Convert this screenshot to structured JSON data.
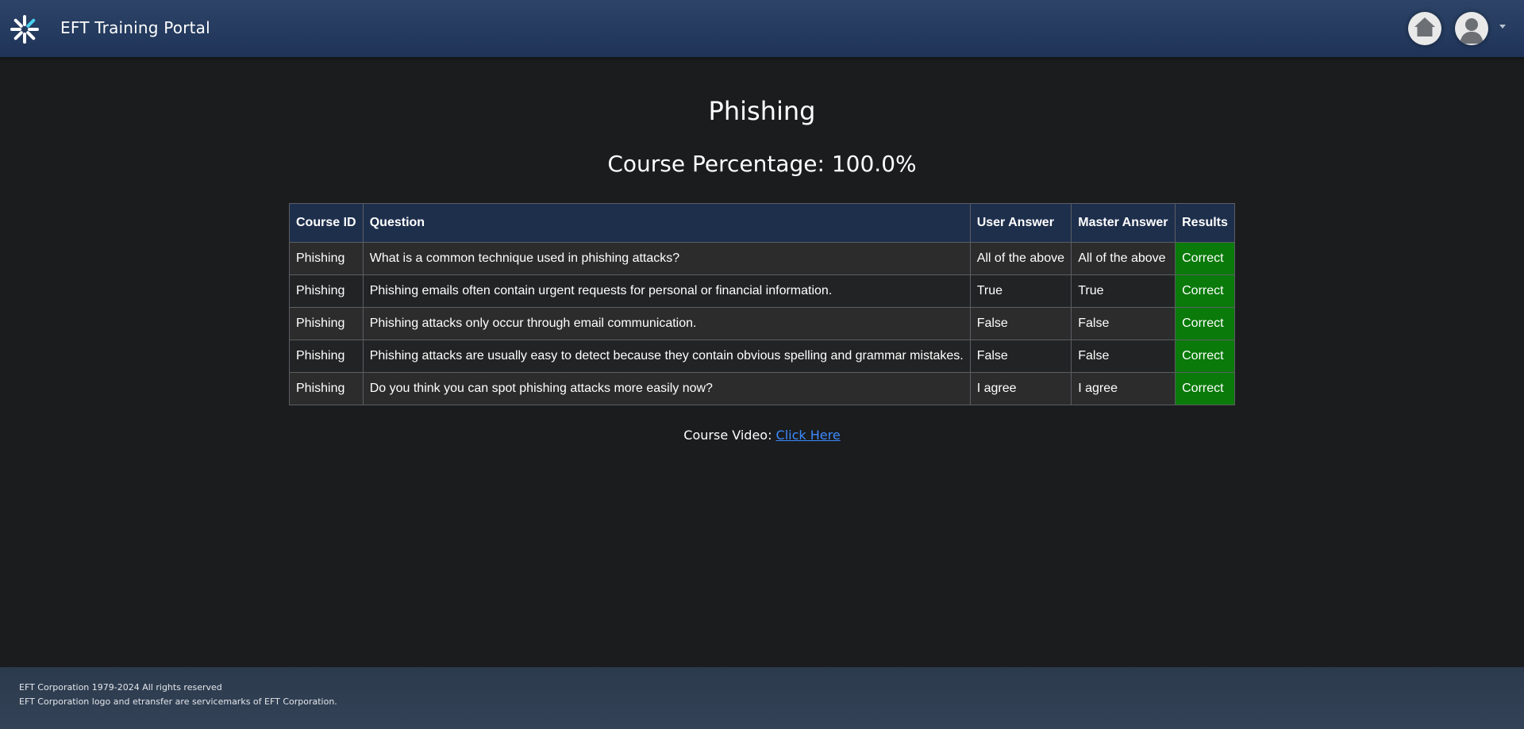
{
  "header": {
    "app_title": "EFT Training Portal",
    "logo_icon": "asterisk-logo-icon",
    "home_icon": "home-icon",
    "avatar_icon": "user-avatar-icon",
    "menu_icon": "caret-down-icon"
  },
  "main": {
    "title": "Phishing",
    "percentage_text": "Course Percentage: 100.0%"
  },
  "table": {
    "headers": [
      "Course ID",
      "Question",
      "User Answer",
      "Master Answer",
      "Results"
    ],
    "rows": [
      [
        "Phishing",
        "What is a common technique used in phishing attacks?",
        "All of the above",
        "All of the above",
        "Correct"
      ],
      [
        "Phishing",
        "Phishing emails often contain urgent requests for personal or financial information.",
        "True",
        "True",
        "Correct"
      ],
      [
        "Phishing",
        "Phishing attacks only occur through email communication.",
        "False",
        "False",
        "Correct"
      ],
      [
        "Phishing",
        "Phishing attacks are usually easy to detect because they contain obvious spelling and grammar mistakes.",
        "False",
        "False",
        "Correct"
      ],
      [
        "Phishing",
        "Do you think you can spot phishing attacks more easily now?",
        "I agree",
        "I agree",
        "Correct"
      ]
    ]
  },
  "video": {
    "label": "Course Video: ",
    "link_text": "Click Here"
  },
  "footer": {
    "line1": "EFT Corporation 1979-2024 All rights reserved",
    "line2": "EFT Corporation logo and etransfer are servicemarks of EFT Corporation."
  },
  "colors": {
    "header_bg": "#243a5e",
    "page_bg": "#1b1c1e",
    "table_header_bg": "#1e2f4c",
    "result_correct_bg": "#0a7a0a",
    "link": "#3b8bff",
    "logo_accent": "#49d1f0"
  }
}
